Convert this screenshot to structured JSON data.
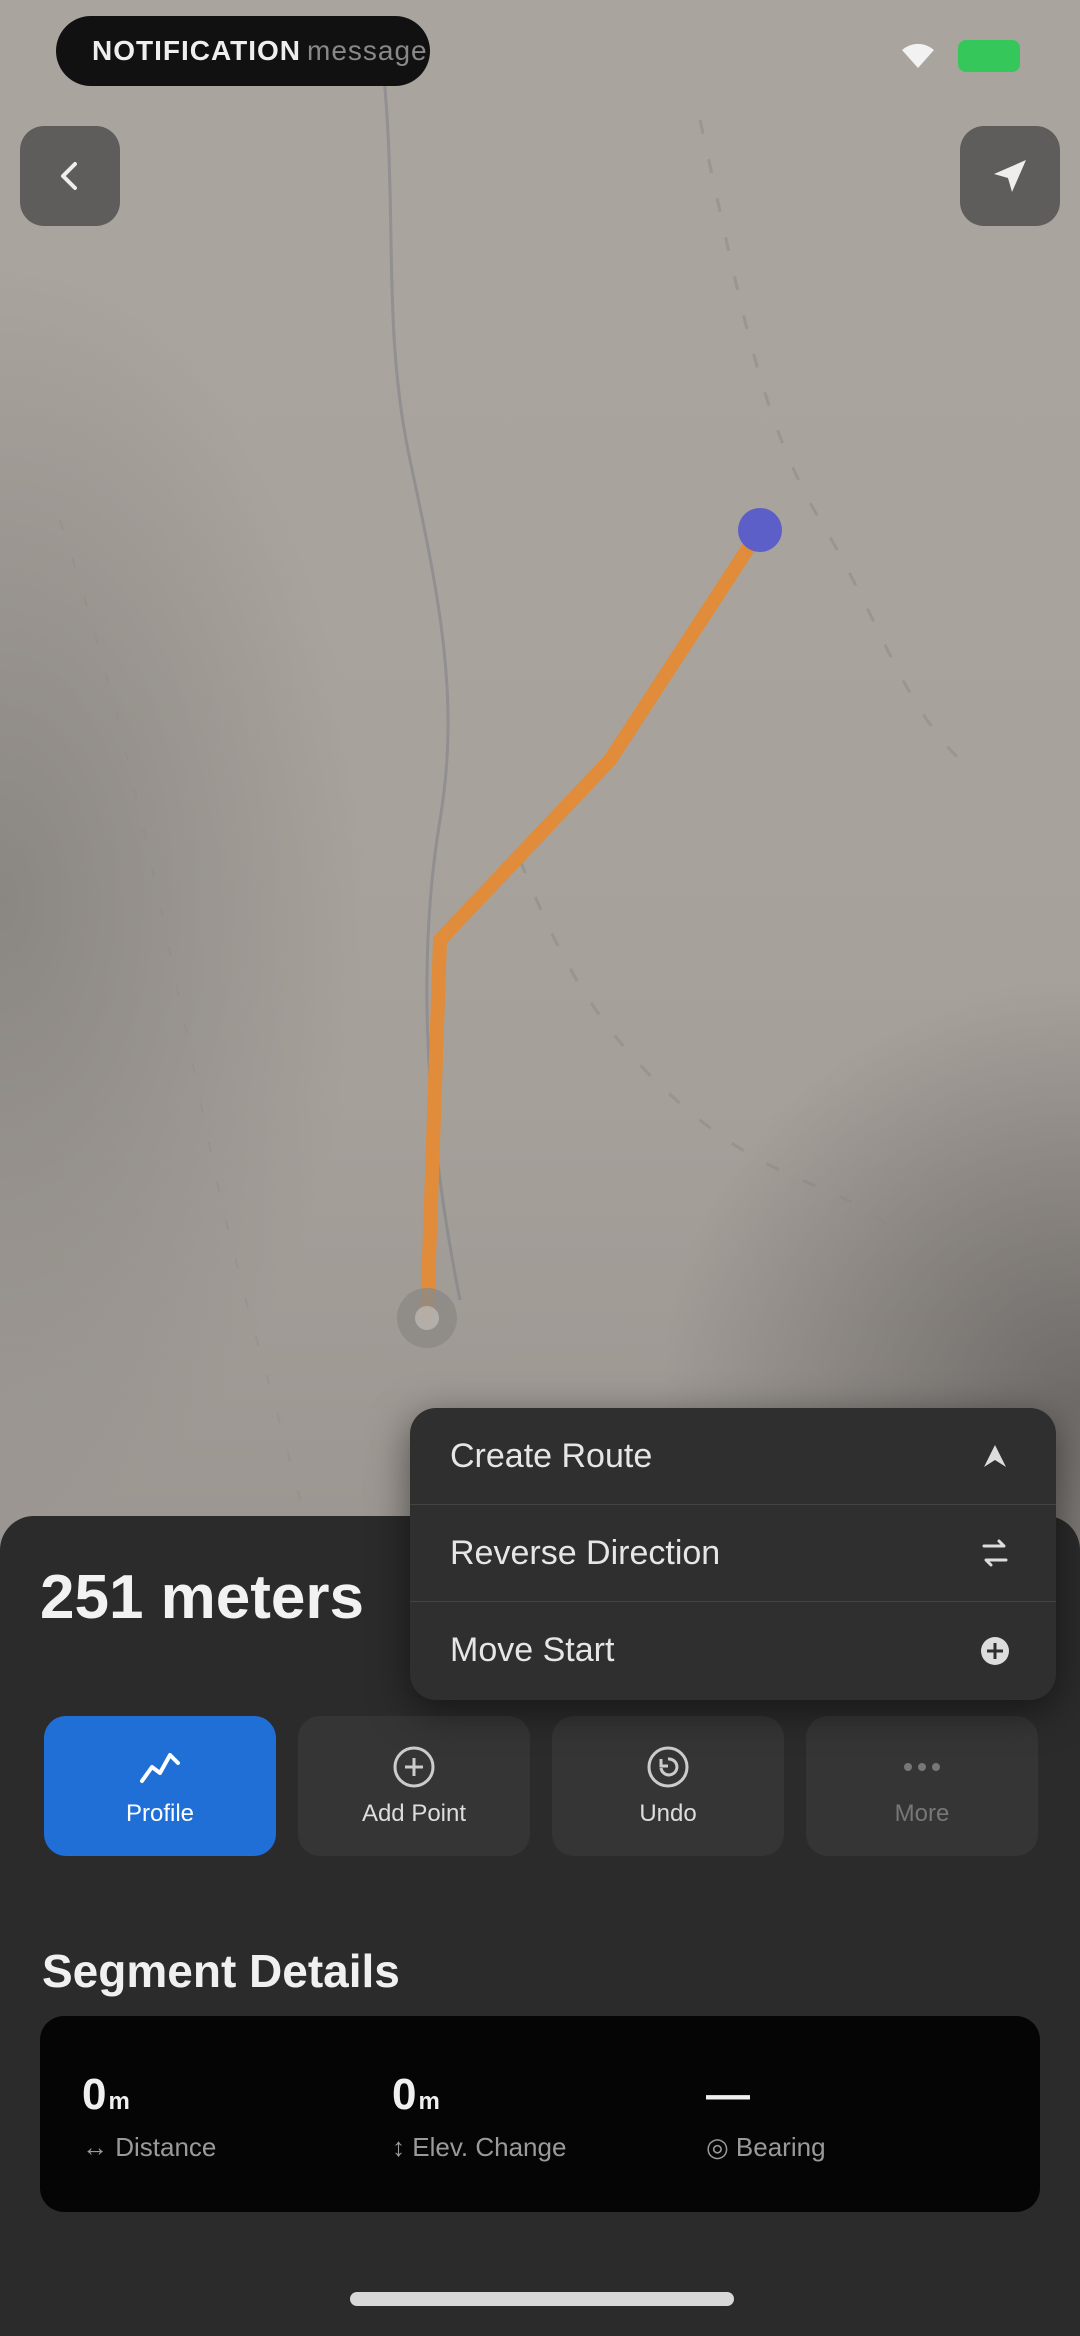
{
  "status_bar": {
    "pill_main": "NOTIFICATION",
    "pill_sub": "message"
  },
  "map": {
    "route_color": "#e08c3a",
    "end_marker_color": "#5b5fc7"
  },
  "context_menu": {
    "items": [
      {
        "label": "Create Route",
        "icon": "route-icon"
      },
      {
        "label": "Reverse Direction",
        "icon": "reverse-icon"
      },
      {
        "label": "Move Start",
        "icon": "move-start-icon"
      }
    ]
  },
  "sheet": {
    "distance": "251 meters",
    "actions": {
      "profile": "Profile",
      "add_point": "Add Point",
      "undo": "Undo",
      "more": "More"
    },
    "segment_title": "Segment Details",
    "stats": {
      "distance_value": "0",
      "distance_unit": "m",
      "distance_label": "Distance",
      "elev_value": "0",
      "elev_unit": "m",
      "elev_label": "Elev. Change",
      "bearing_value": "—",
      "bearing_label": "Bearing"
    }
  },
  "colors": {
    "accent": "#1f6fd6",
    "sheet_bg": "#2b2b2c",
    "battery": "#35c759"
  }
}
